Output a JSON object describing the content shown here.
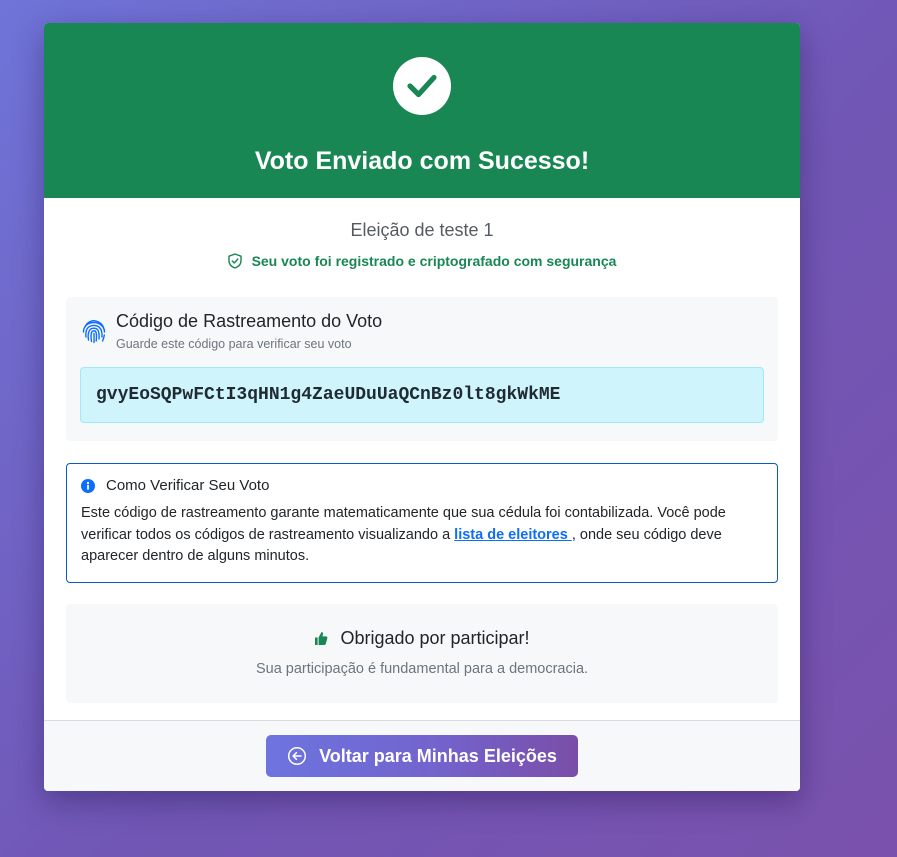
{
  "header": {
    "title": "Voto Enviado com Sucesso!",
    "icon": "check-icon",
    "color": "#198754"
  },
  "election": {
    "name": "Eleição de teste 1",
    "secure_message": "Seu voto foi registrado e criptografado com segurança"
  },
  "tracking": {
    "title": "Código de Rastreamento do Voto",
    "subtitle": "Guarde este código para verificar seu voto",
    "code": "gvyEoSQPwFCtI3qHN1g4ZaeUDuUaQCnBz0lt8gkWkME"
  },
  "verify": {
    "title": "Como Verificar Seu Voto",
    "text_before": "Este código de rastreamento garante matematicamente que sua cédula foi contabilizada. Você pode verificar todos os códigos de rastreamento visualizando a ",
    "link_label": "lista de eleitores ",
    "text_after": ", onde seu código deve aparecer dentro de alguns minutos."
  },
  "thanks": {
    "title": "Obrigado por participar!",
    "subtitle": "Sua participação é fundamental para a democracia."
  },
  "footer": {
    "back_label": "Voltar para Minhas Eleições"
  },
  "colors": {
    "success": "#198754",
    "info_bg": "#cff4fc",
    "link": "#0d6efd",
    "button_gradient_start": "#6d74df",
    "button_gradient_end": "#7a4ea8"
  }
}
